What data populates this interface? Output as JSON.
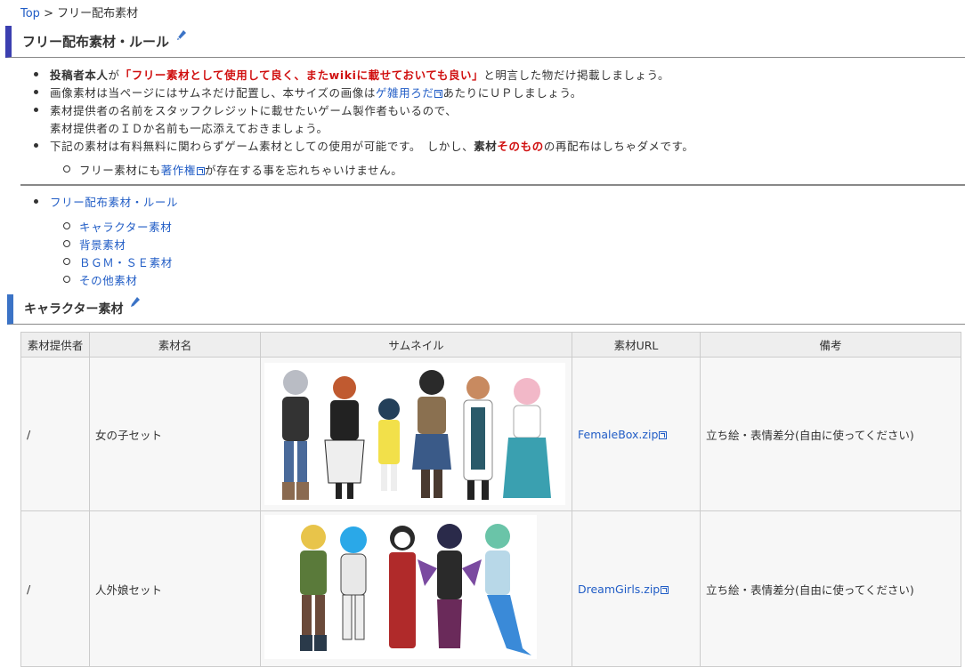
{
  "breadcrumb": {
    "top": "Top",
    "sep": " > ",
    "current": "フリー配布素材"
  },
  "section1": {
    "title": "フリー配布素材・ルール",
    "rules": [
      {
        "prefix": "投稿者本人",
        "mid": "が",
        "red": "「フリー素材として使用して良く、またwikiに載せておいても良い」",
        "suffix": "と明言した物だけ掲載しましょう。"
      },
      {
        "pre": "画像素材は当ページにはサムネだけ配置し、本サイズの画像は",
        "link": "ゲ雑用ろだ",
        "post": "あたりにＵＰしましょう。"
      },
      {
        "line1": "素材提供者の名前をスタッフクレジットに載せたいゲーム製作者もいるので、",
        "line2": "素材提供者のＩＤか名前も一応添えておきましょう。"
      },
      {
        "pre": "下記の素材は有料無料に関わらずゲーム素材としての使用が可能です。　しかし、",
        "bold": "素材",
        "red": "そのもの",
        "post": "の再配布はしちゃダメです。"
      }
    ],
    "sub_rule": {
      "pre": "フリー素材にも",
      "link": "著作権",
      "post": "が存在する事を忘れちゃいけません。"
    }
  },
  "toc": {
    "top": "フリー配布素材・ルール",
    "items": [
      "キャラクター素材",
      "背景素材",
      "ＢＧＭ・ＳＥ素材",
      "その他素材"
    ]
  },
  "section2": {
    "title": "キャラクター素材"
  },
  "table": {
    "headers": [
      "素材提供者",
      "素材名",
      "サムネイル",
      "素材URL",
      "備考"
    ],
    "rows": [
      {
        "provider": "/",
        "name": "女の子セット",
        "url": "FemaleBox.zip",
        "note": "立ち絵・表情差分(自由に使ってください)"
      },
      {
        "provider": "/",
        "name": "人外娘セット",
        "url": "DreamGirls.zip",
        "note": "立ち絵・表情差分(自由に使ってください)"
      }
    ]
  },
  "colors": {
    "link": "#215dc6",
    "red": "#d01010",
    "h2_bar": "#3b3fb0",
    "h3_bar": "#3b73c6"
  }
}
